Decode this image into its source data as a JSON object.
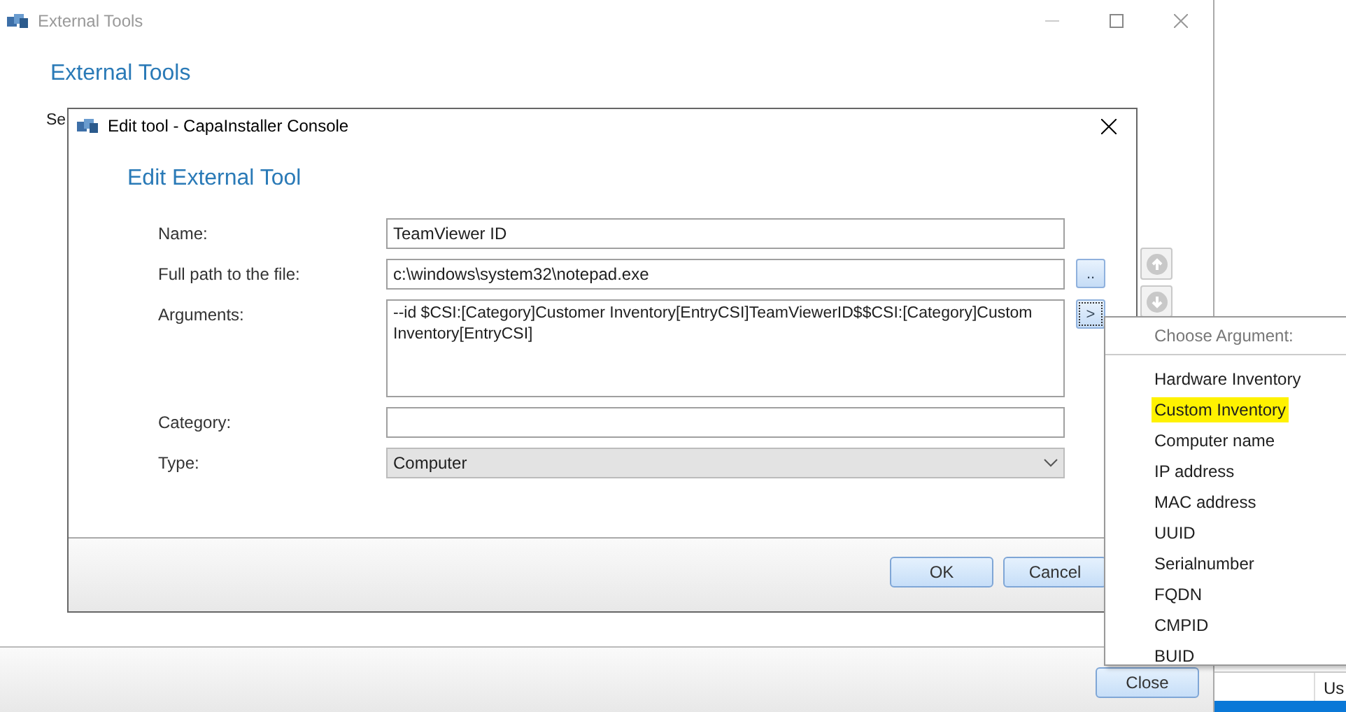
{
  "main_window": {
    "title": "External Tools",
    "heading": "External Tools",
    "intro": "Se",
    "close_button": "Close",
    "table": {
      "column_2_header": "Us"
    }
  },
  "dialog": {
    "title": "Edit tool - CapaInstaller Console",
    "heading": "Edit External Tool",
    "fields": [
      {
        "label": "Name:",
        "value": "TeamViewer ID",
        "kind": "text"
      },
      {
        "label": "Full path to the file:",
        "value": "c:\\windows\\system32\\notepad.exe",
        "kind": "text"
      },
      {
        "label": "Arguments:",
        "value": "--id $CSI:[Category]Customer Inventory[EntryCSI]TeamViewerID$$CSI:[Category]Custom Inventory[EntryCSI]",
        "kind": "multiline"
      },
      {
        "label": "Category:",
        "kind": "text"
      },
      {
        "label": "Type:",
        "value": "Computer",
        "kind": "dropdown"
      }
    ],
    "browse_button": "..",
    "argument_button": ">",
    "buttons": [
      "OK",
      "Cancel"
    ]
  },
  "argument_menu": {
    "title": "Choose Argument:",
    "items": [
      {
        "label": "Hardware Inventory",
        "highlighted": false
      },
      {
        "label": "Custom Inventory",
        "highlighted": true
      },
      {
        "label": "Computer name",
        "highlighted": false
      },
      {
        "label": "IP address",
        "highlighted": false
      },
      {
        "label": "MAC address",
        "highlighted": false
      },
      {
        "label": "UUID",
        "highlighted": false
      },
      {
        "label": "Serialnumber",
        "highlighted": false
      },
      {
        "label": "FQDN",
        "highlighted": false
      },
      {
        "label": "CMPID",
        "highlighted": false
      },
      {
        "label": "BUID",
        "highlighted": false
      }
    ]
  }
}
